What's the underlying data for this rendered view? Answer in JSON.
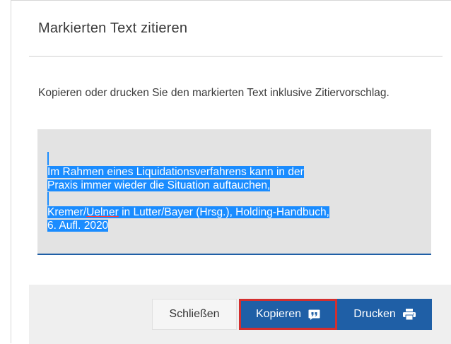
{
  "dialog": {
    "title": "Markierten Text zitieren",
    "description": "Kopieren oder drucken Sie den markierten Text inklusive Zitiervorschlag.",
    "citation": {
      "line1": "Im Rahmen eines Liquidationsverfahrens kann in der",
      "line2": "Praxis immer wieder die Situation auftauchen,",
      "author_a": "Kremer/",
      "author_b": "Uelner",
      "line3_rest": " in Lutter/Bayer (Hrsg.), Holding-Handbuch,",
      "line4": "6. Aufl. 2020"
    },
    "buttons": {
      "close_label": "Schließen",
      "copy_label": "Kopieren",
      "print_label": "Drucken"
    }
  },
  "colors": {
    "primary": "#1f5fa6",
    "selection": "#1a8cff",
    "focus_outline": "#d32f2f"
  },
  "icons": {
    "copy": "quote-icon",
    "print": "printer-icon"
  }
}
